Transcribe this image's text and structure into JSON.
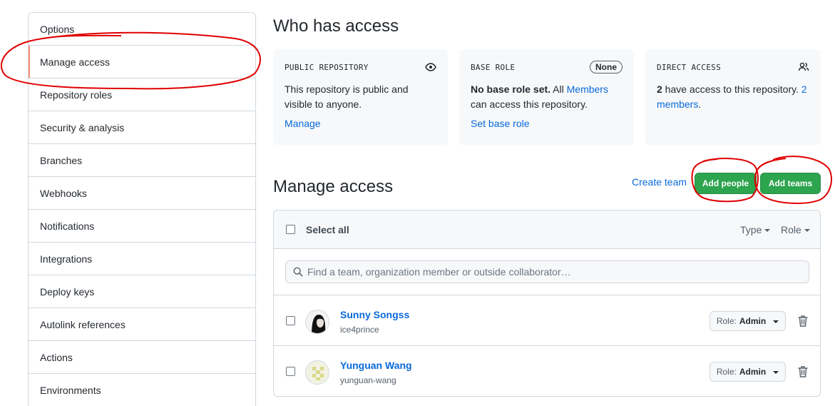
{
  "sidebar": {
    "items": [
      {
        "label": "Options"
      },
      {
        "label": "Manage access"
      },
      {
        "label": "Repository roles"
      },
      {
        "label": "Security & analysis"
      },
      {
        "label": "Branches"
      },
      {
        "label": "Webhooks"
      },
      {
        "label": "Notifications"
      },
      {
        "label": "Integrations"
      },
      {
        "label": "Deploy keys"
      },
      {
        "label": "Autolink references"
      },
      {
        "label": "Actions"
      },
      {
        "label": "Environments"
      }
    ],
    "active_index": 1
  },
  "who_has_access": {
    "title": "Who has access",
    "public_repo": {
      "label": "PUBLIC REPOSITORY",
      "text": "This repository is public and visible to anyone.",
      "action": "Manage",
      "icon": "eye-icon"
    },
    "base_role": {
      "label": "BASE ROLE",
      "badge": "None",
      "bold": "No base role set.",
      "text_pre": " All ",
      "link": "Members",
      "text_post": " can access this repository.",
      "action": "Set base role"
    },
    "direct_access": {
      "label": "DIRECT ACCESS",
      "icon": "people-icon",
      "count": "2",
      "text": " have access to this repository. ",
      "link": "2 members",
      "suffix": "."
    }
  },
  "manage_access": {
    "title": "Manage access",
    "create_team": "Create team",
    "add_people": "Add people",
    "add_teams": "Add teams",
    "select_all": "Select all",
    "type_filter": "Type",
    "role_filter": "Role",
    "search_placeholder": "Find a team, organization member or outside collaborator…",
    "members": [
      {
        "name": "Sunny Songss",
        "login": "ice4prince",
        "role_prefix": "Role:",
        "role": "Admin"
      },
      {
        "name": "Yunguan Wang",
        "login": "yunguan-wang",
        "role_prefix": "Role:",
        "role": "Admin"
      }
    ]
  },
  "colors": {
    "accent_link": "#0969da",
    "primary_button": "#2da44e",
    "annotation": "#e00000",
    "active_marker": "#fd8c73"
  }
}
